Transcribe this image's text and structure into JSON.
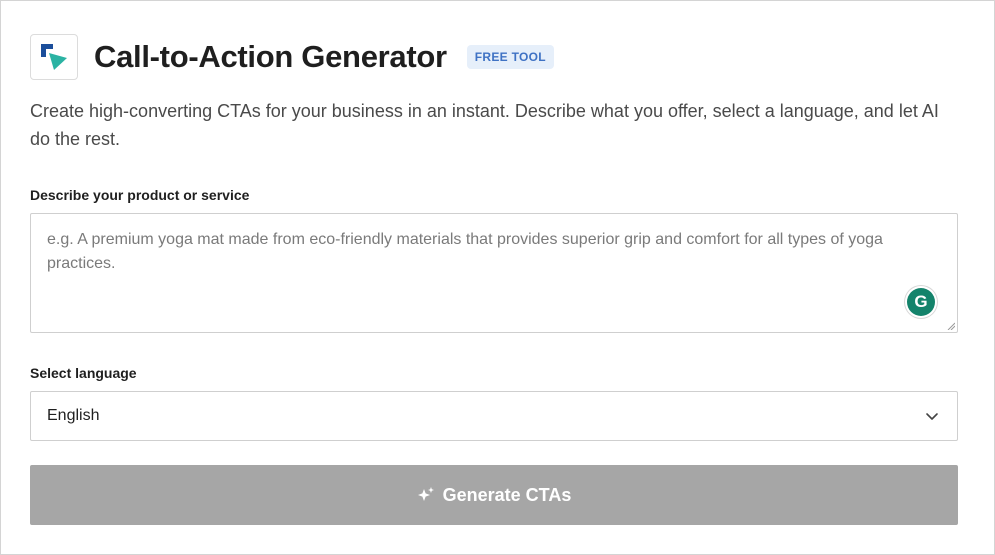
{
  "header": {
    "title": "Call-to-Action Generator",
    "badge": "FREE TOOL",
    "logo_icon": "brand-logo-icon"
  },
  "description": "Create high-converting CTAs for your business in an instant. Describe what you offer, select a language, and let AI do the rest.",
  "product_field": {
    "label": "Describe your product or service",
    "value": "",
    "placeholder": "e.g. A premium yoga mat made from eco-friendly materials that provides superior grip and comfort for all types of yoga practices.",
    "assistant_icon": "grammarly-icon",
    "assistant_letter": "G"
  },
  "language_field": {
    "label": "Select language",
    "selected": "English",
    "icon": "chevron-down-icon"
  },
  "generate_button": {
    "label": "Generate CTAs",
    "icon": "sparkle-icon"
  },
  "colors": {
    "badge_bg": "#e6effa",
    "badge_text": "#3f72c4",
    "button_disabled": "#a6a6a6",
    "logo_blue": "#1b4e9b",
    "logo_teal": "#2bb3a3"
  }
}
